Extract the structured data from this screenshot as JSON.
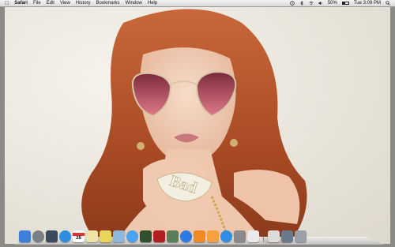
{
  "menubar": {
    "apple_icon": "apple-logo-icon",
    "app_name": "Safari",
    "menus": [
      "File",
      "Edit",
      "View",
      "History",
      "Bookmarks",
      "Window",
      "Help"
    ],
    "status": {
      "battery_percent": "50%",
      "battery_fill": 0.5,
      "clock": "Tue 3:09 PM",
      "icons": [
        "time-machine-icon",
        "bluetooth-icon",
        "wifi-icon",
        "volume-icon",
        "spotlight-icon"
      ]
    }
  },
  "wallpaper": {
    "ring_text": "Bad",
    "colors": {
      "hair": "#b4532a",
      "wall": "#ebe7de",
      "lens": "#c0445a",
      "skin": "#f0cbb2"
    }
  },
  "dock": {
    "apps": [
      {
        "name": "finder-icon",
        "color": "#3d7fd9",
        "label": ""
      },
      {
        "name": "launchpad-icon",
        "color": "#7c7f86",
        "label": ""
      },
      {
        "name": "mission-control-icon",
        "color": "#3b4a5a",
        "label": ""
      },
      {
        "name": "safari-icon",
        "color": "#2d8de0",
        "label": ""
      },
      {
        "name": "calendar-icon",
        "color": "#ffffff",
        "label": "28"
      },
      {
        "name": "notes-icon",
        "color": "#f1e3a3",
        "label": ""
      },
      {
        "name": "stickies-icon",
        "color": "#e8d65a",
        "label": ""
      },
      {
        "name": "preview-icon",
        "color": "#8fb8d8",
        "label": ""
      },
      {
        "name": "messages-icon",
        "color": "#4aa3f0",
        "label": ""
      },
      {
        "name": "facetime-icon",
        "color": "#2f4f2f",
        "label": ""
      },
      {
        "name": "photo-booth-icon",
        "color": "#b02020",
        "label": ""
      },
      {
        "name": "iphoto-icon",
        "color": "#5a7d5a",
        "label": ""
      },
      {
        "name": "itunes-icon",
        "color": "#2c7be5",
        "label": ""
      },
      {
        "name": "ibooks-icon",
        "color": "#f08a24",
        "label": ""
      },
      {
        "name": "pages-icon",
        "color": "#f4a340",
        "label": ""
      },
      {
        "name": "app-store-icon",
        "color": "#2f8ee8",
        "label": ""
      },
      {
        "name": "system-preferences-icon",
        "color": "#8a8a8a",
        "label": ""
      },
      {
        "name": "textedit-icon",
        "color": "#e9e9e9",
        "label": ""
      }
    ],
    "others": [
      {
        "name": "documents-stack-icon",
        "color": "#dcdcdc"
      },
      {
        "name": "downloads-stack-icon",
        "color": "#6a7a8a"
      },
      {
        "name": "trash-icon",
        "color": "#9aa0a6"
      }
    ]
  }
}
